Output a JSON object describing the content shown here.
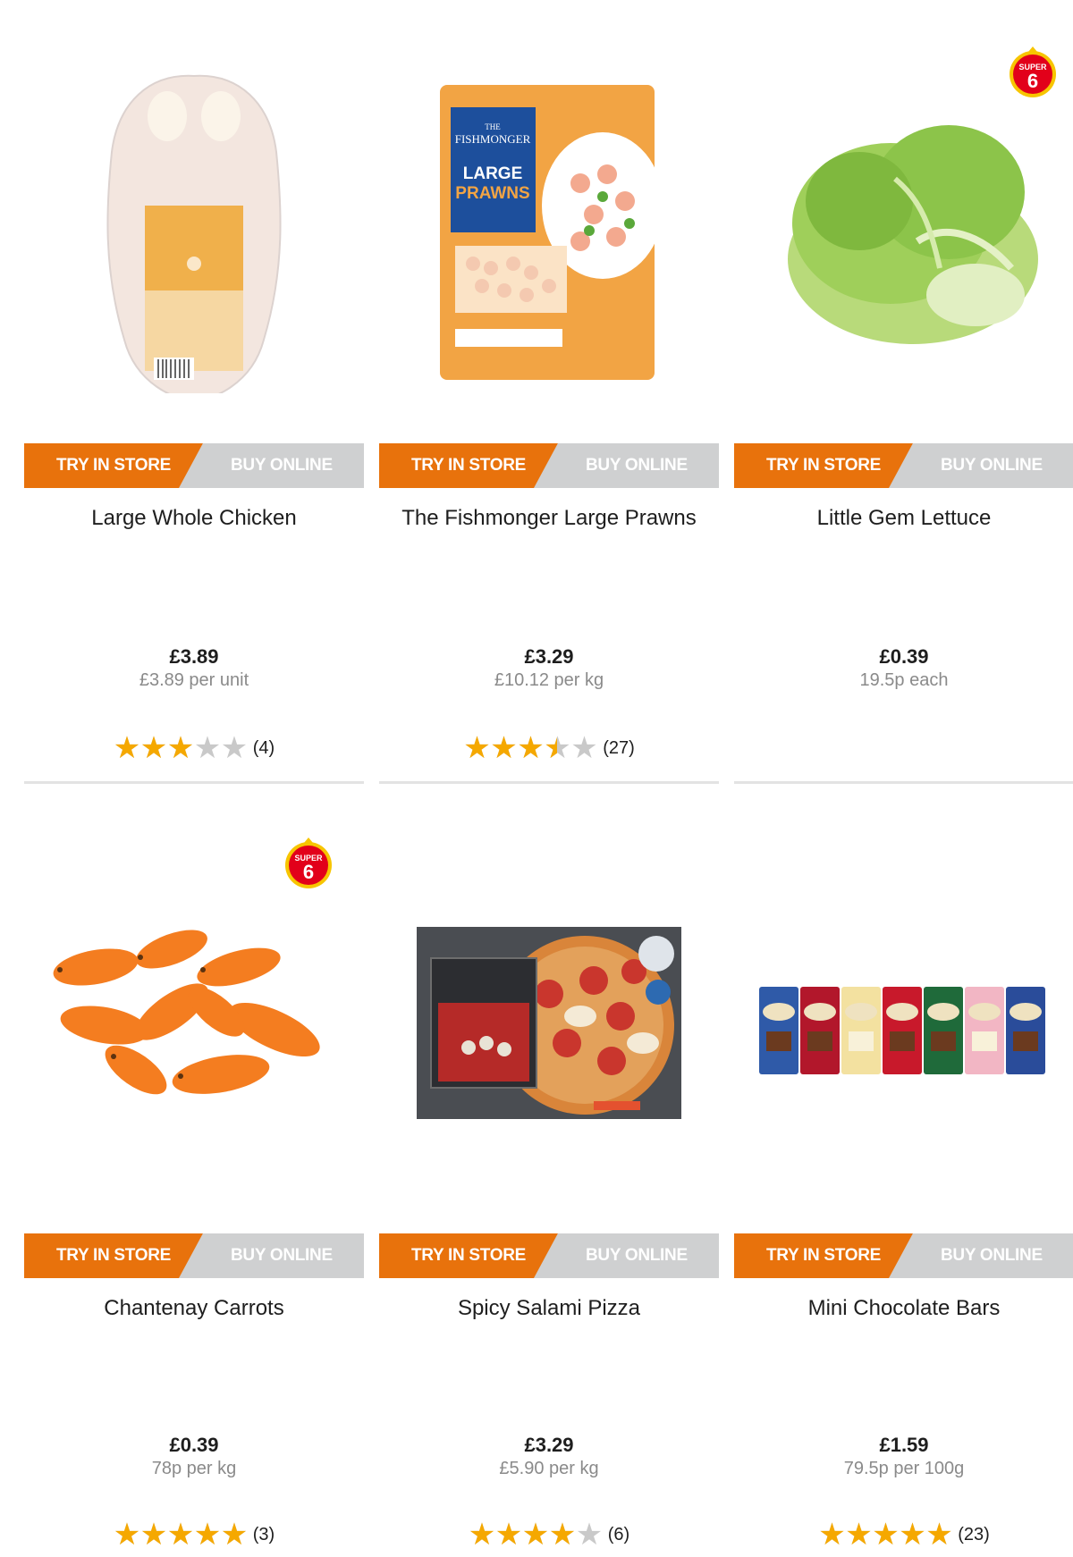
{
  "labels": {
    "try_in_store": "TRY IN STORE",
    "buy_online": "BUY ONLINE",
    "super_top": "SUPER",
    "super_num": "6"
  },
  "colors": {
    "accent_orange": "#e8720c",
    "tab_grey": "#cfd0d1",
    "star_gold": "#f5a800",
    "star_grey": "#c9c9c9",
    "badge_red": "#e2001a"
  },
  "products": [
    {
      "name": "Large Whole Chicken",
      "price": "£3.89",
      "unit_price": "£3.89 per unit",
      "rating": 3,
      "review_count": "(4)",
      "super6": false,
      "image": "whole-chicken"
    },
    {
      "name": "The Fishmonger Large Prawns",
      "price": "£3.29",
      "unit_price": "£10.12 per kg",
      "rating": 3.5,
      "review_count": "(27)",
      "super6": false,
      "image": "prawns-pack",
      "pack_text": [
        "THE",
        "FISHMONGER",
        "LARGE",
        "PRAWNS"
      ]
    },
    {
      "name": "Little Gem Lettuce",
      "price": "£0.39",
      "unit_price": "19.5p each",
      "rating": null,
      "review_count": "",
      "super6": true,
      "image": "lettuce"
    },
    {
      "name": "Chantenay Carrots",
      "price": "£0.39",
      "unit_price": "78p per kg",
      "rating": 5,
      "review_count": "(3)",
      "super6": true,
      "image": "carrots"
    },
    {
      "name": "Spicy Salami Pizza",
      "price": "£3.29",
      "unit_price": "£5.90 per kg",
      "rating": 4,
      "review_count": "(6)",
      "super6": false,
      "image": "pizza-box"
    },
    {
      "name": "Mini Chocolate Bars",
      "price": "£1.59",
      "unit_price": "79.5p per 100g",
      "rating": 5,
      "review_count": "(23)",
      "super6": false,
      "image": "chocolate-bars"
    }
  ]
}
